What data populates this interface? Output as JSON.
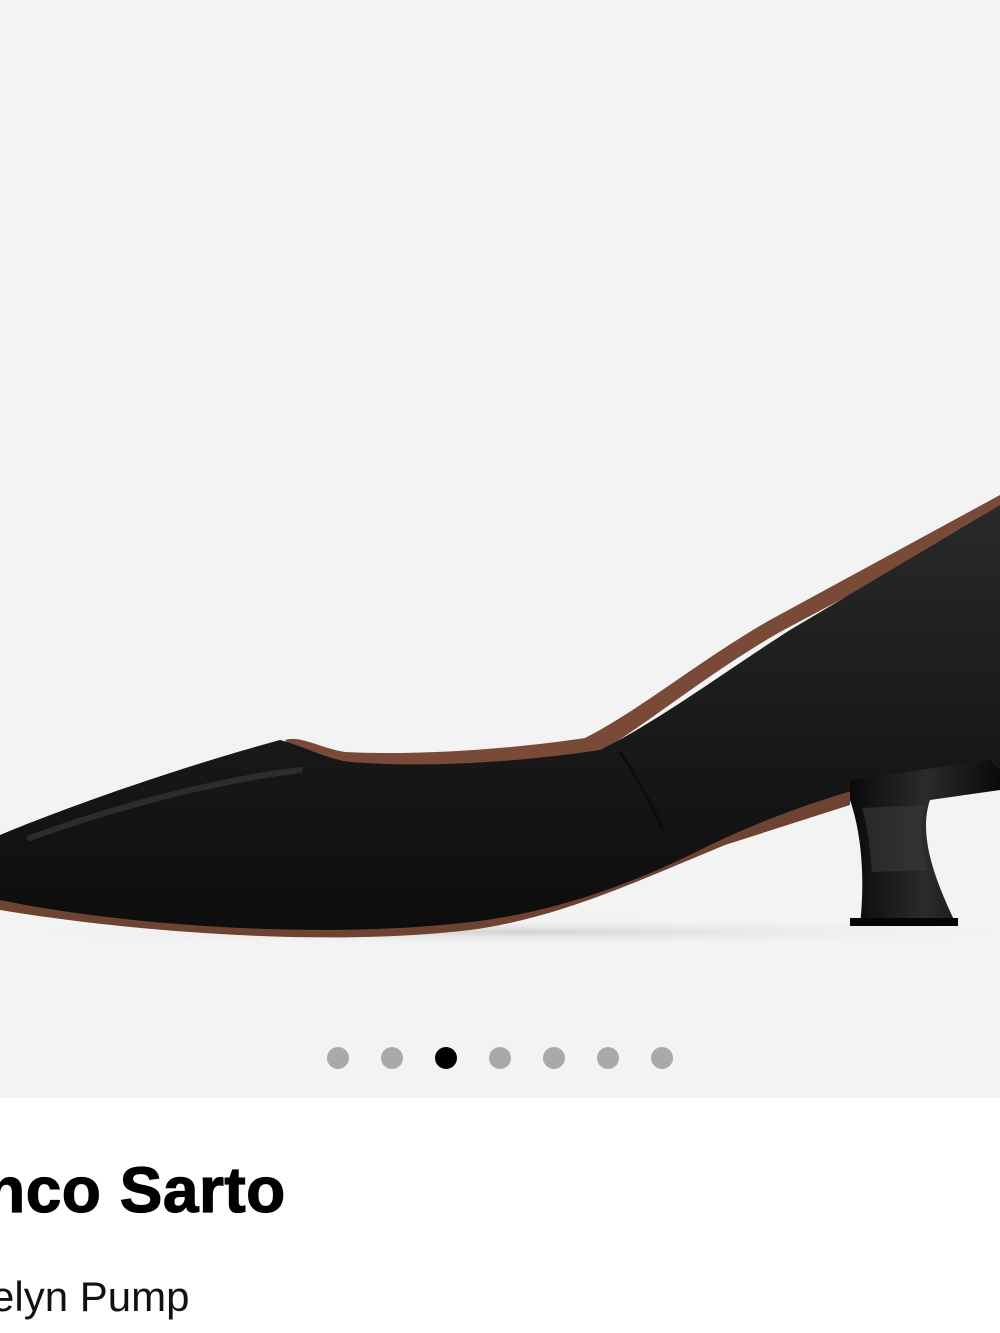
{
  "gallery": {
    "image": "black-pointed-toe-kitten-heel-pump",
    "dot_count": 7,
    "active_index": 2,
    "colors": {
      "background": "#f3f3f3",
      "dot": "#a9a9a9",
      "dot_active": "#000000",
      "shoe": "#1c1c1c",
      "lining": "#7a4a38"
    }
  },
  "product": {
    "brand": "anco Sarto",
    "name": "celyn Pump"
  }
}
